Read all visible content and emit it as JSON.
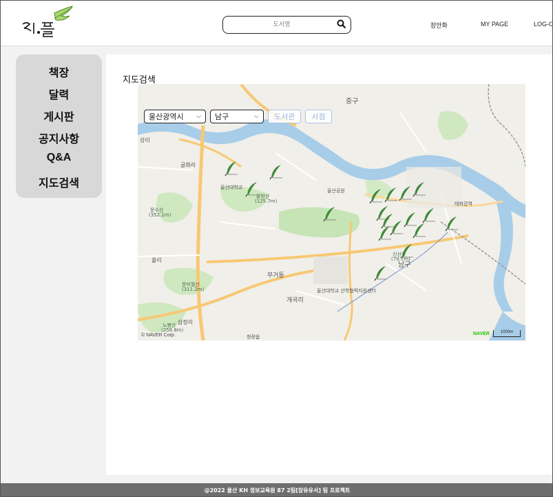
{
  "header": {
    "logo_text": "리플",
    "search_placeholder": "도서명",
    "user_name": "장안화",
    "mypage_label": "MY PAGE",
    "logout_label": "LOG-OU"
  },
  "sidebar": {
    "items": [
      {
        "label": "책장"
      },
      {
        "label": "달력"
      },
      {
        "label": "게시판"
      },
      {
        "label": "공지사항"
      },
      {
        "label": "Q&A"
      },
      {
        "label": "지도검색"
      }
    ]
  },
  "main": {
    "title": "지도검색",
    "map": {
      "city_select": "울산광역시",
      "district_select": "남구",
      "library_button": "도서관",
      "bookstore_button": "서점",
      "labels": {
        "junggu": "중구",
        "namgu": "남구",
        "gulhwa": "굴화리",
        "samjeong": "삼정리",
        "yulli": "율리",
        "mugeo": "무거동",
        "sangri": "상리",
        "gaegok": "개곡리",
        "hwangbang": "황방산",
        "hwangbang_h": "(125.7m)",
        "munsu": "문수산",
        "munsu_h": "(352.1m)",
        "sinseon": "신선산",
        "sinseon_h": "(79.7m)",
        "nanmeung": "노봉산",
        "nanmeung_h": "(258.8m)",
        "munmil": "문미월산",
        "munmil_h": "(311.2m)",
        "yeoksa": "태화강역",
        "ulsan_univ": "울산대학교",
        "ulsan_univ_lib": "울산대학교 산학협력지원센터",
        "hospital": "울산공원",
        "cheongnyang": "청량읍"
      },
      "copyright": "© NAVER Corp.",
      "naver": "NAVER",
      "scale": "1000m",
      "markers": [
        {
          "name": "bookstore-1"
        },
        {
          "name": "bookstore-2"
        },
        {
          "name": "bookstore-3"
        },
        {
          "name": "bookstore-4"
        },
        {
          "name": "bookstore-5"
        },
        {
          "name": "bookstore-6"
        },
        {
          "name": "bookstore-7"
        },
        {
          "name": "bookstore-8"
        },
        {
          "name": "bookstore-9"
        },
        {
          "name": "bookstore-10"
        },
        {
          "name": "bookstore-11"
        },
        {
          "name": "bookstore-12"
        },
        {
          "name": "bookstore-13"
        },
        {
          "name": "bookstore-14"
        },
        {
          "name": "bookstore-15"
        },
        {
          "name": "bookstore-16"
        },
        {
          "name": "bookstore-17"
        }
      ]
    }
  },
  "footer": {
    "text": "@2022 울산 KH 정보교육원 87 2팀[장유유서] 팀 프로젝트"
  },
  "colors": {
    "river": "#a8cde8",
    "park": "#c6e4b6",
    "road_major": "#f7c874",
    "marker": "#3f8a3c",
    "footer": "#6e6e6e",
    "sidebar": "#d8d8d8"
  }
}
